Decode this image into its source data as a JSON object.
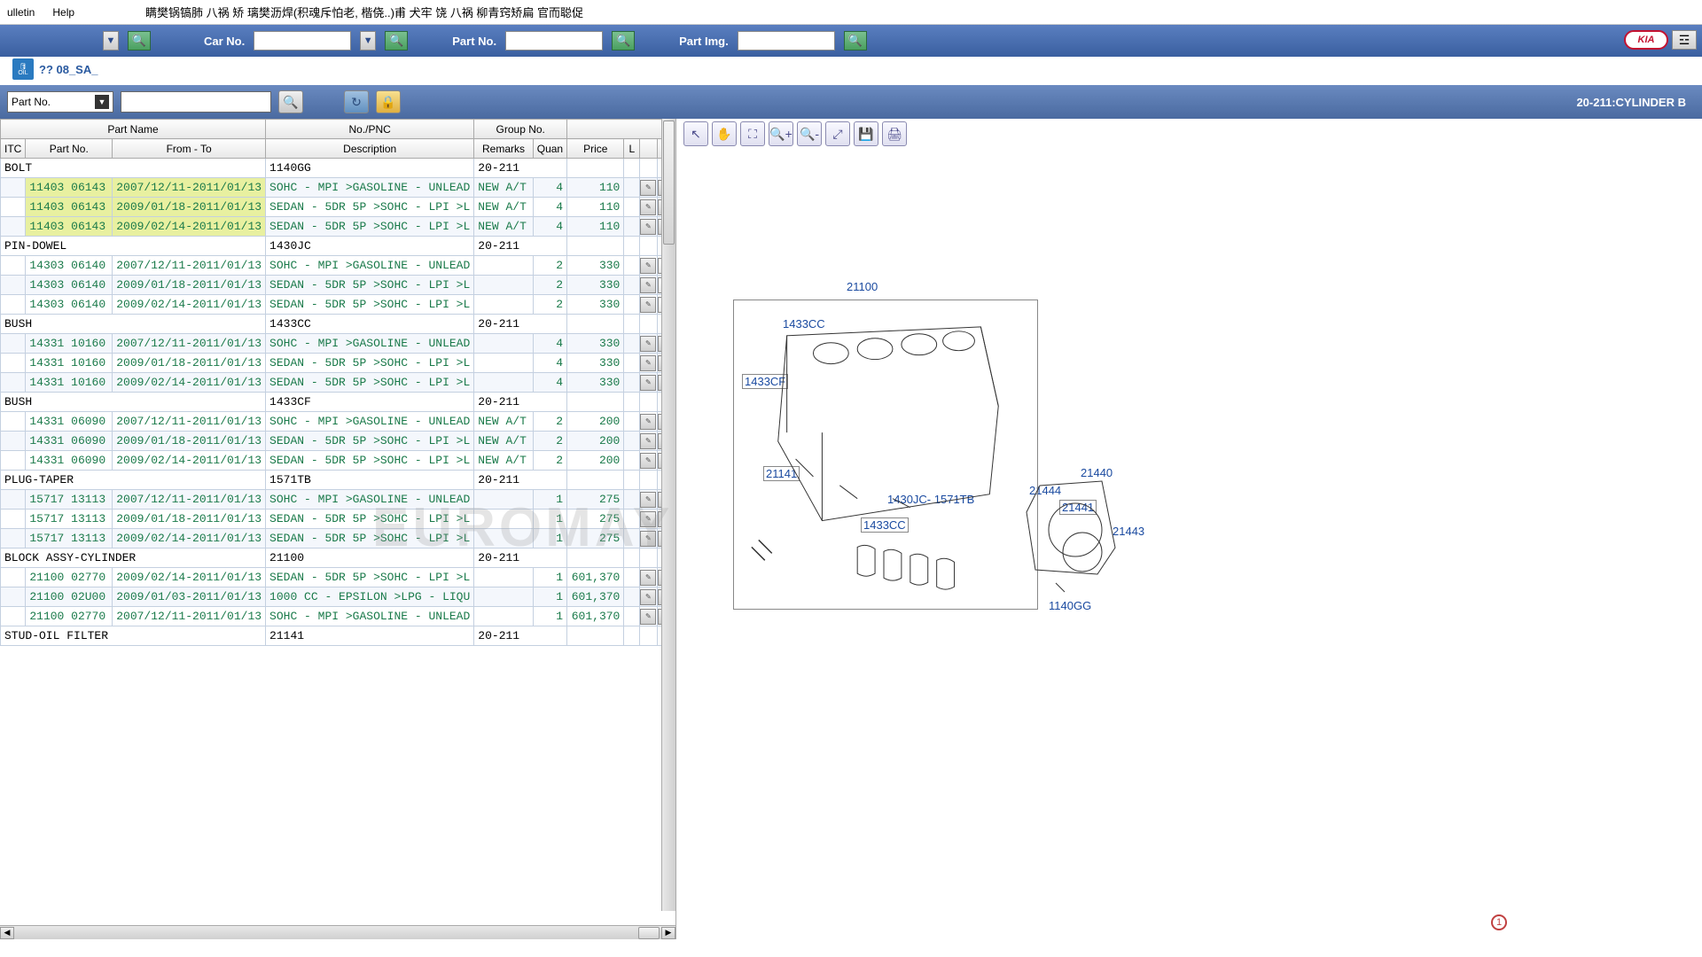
{
  "menu": {
    "bulletin": "ulletin",
    "help": "Help"
  },
  "banner": "瞒樊锅镐肺 八祸 矫 璃樊沥焊(积魂斥怕老, 楷侥..)甫 犬牢 饶 八祸 柳青窍矫扁 官而聪促",
  "search": {
    "car_label": "Car No.",
    "part_label": "Part No.",
    "img_label": "Part Img.",
    "kia": "KIA"
  },
  "tab": {
    "oil": "OIL",
    "label": "?? 08_SA_"
  },
  "toolbar2": {
    "partno": "Part No."
  },
  "diagram_title": "20-211:CYLINDER B",
  "headers": {
    "part_name": "Part Name",
    "no_pnc": "No./PNC",
    "group_no": "Group No.",
    "itc": "ITC",
    "part_no": "Part No.",
    "from_to": "From - To",
    "description": "Description",
    "remarks": "Remarks",
    "qty": "Quan",
    "price": "Price",
    "l": "L"
  },
  "groups": [
    {
      "name": "BOLT",
      "pnc": "1140GG",
      "grp": "20-211",
      "rows": [
        {
          "hl": true,
          "pn": "11403 06143",
          "ft": "2007/12/11-2011/01/13",
          "desc": "SOHC - MPI >GASOLINE - UNLEAD",
          "rem": "NEW A/T",
          "qty": "4",
          "price": "110",
          "multi": false
        },
        {
          "hl": true,
          "pn": "11403 06143",
          "ft": "2009/01/18-2011/01/13",
          "desc": "SEDAN - 5DR 5P >SOHC - LPI >L",
          "rem": "NEW A/T",
          "qty": "4",
          "price": "110",
          "multi": false
        },
        {
          "hl": true,
          "pn": "11403 06143",
          "ft": "2009/02/14-2011/01/13",
          "desc": "SEDAN - 5DR 5P >SOHC - LPI >L",
          "rem": "NEW A/T",
          "qty": "4",
          "price": "110",
          "multi": false
        }
      ]
    },
    {
      "name": "PIN-DOWEL",
      "pnc": "1430JC",
      "grp": "20-211",
      "rows": [
        {
          "pn": "14303 06140",
          "ft": "2007/12/11-2011/01/13",
          "desc": "SOHC - MPI >GASOLINE - UNLEAD",
          "rem": "",
          "qty": "2",
          "price": "330",
          "multi": true
        },
        {
          "pn": "14303 06140",
          "ft": "2009/01/18-2011/01/13",
          "desc": "SEDAN - 5DR 5P >SOHC - LPI >L",
          "rem": "",
          "qty": "2",
          "price": "330",
          "multi": true
        },
        {
          "pn": "14303 06140",
          "ft": "2009/02/14-2011/01/13",
          "desc": "SEDAN - 5DR 5P >SOHC - LPI >L",
          "rem": "",
          "qty": "2",
          "price": "330",
          "multi": true
        }
      ]
    },
    {
      "name": "BUSH",
      "pnc": "1433CC",
      "grp": "20-211",
      "rows": [
        {
          "pn": "14331 10160",
          "ft": "2007/12/11-2011/01/13",
          "desc": "SOHC - MPI >GASOLINE - UNLEAD",
          "rem": "",
          "qty": "4",
          "price": "330",
          "multi": false
        },
        {
          "pn": "14331 10160",
          "ft": "2009/01/18-2011/01/13",
          "desc": "SEDAN - 5DR 5P >SOHC - LPI >L",
          "rem": "",
          "qty": "4",
          "price": "330",
          "multi": false
        },
        {
          "pn": "14331 10160",
          "ft": "2009/02/14-2011/01/13",
          "desc": "SEDAN - 5DR 5P >SOHC - LPI >L",
          "rem": "",
          "qty": "4",
          "price": "330",
          "multi": false
        }
      ]
    },
    {
      "name": "BUSH",
      "pnc": "1433CF",
      "grp": "20-211",
      "rows": [
        {
          "pn": "14331 06090",
          "ft": "2007/12/11-2011/01/13",
          "desc": "SOHC - MPI >GASOLINE - UNLEAD",
          "rem": "NEW A/T",
          "qty": "2",
          "price": "200",
          "multi": false
        },
        {
          "pn": "14331 06090",
          "ft": "2009/01/18-2011/01/13",
          "desc": "SEDAN - 5DR 5P >SOHC - LPI >L",
          "rem": "NEW A/T",
          "qty": "2",
          "price": "200",
          "multi": false
        },
        {
          "pn": "14331 06090",
          "ft": "2009/02/14-2011/01/13",
          "desc": "SEDAN - 5DR 5P >SOHC - LPI >L",
          "rem": "NEW A/T",
          "qty": "2",
          "price": "200",
          "multi": false
        }
      ]
    },
    {
      "name": "PLUG-TAPER",
      "pnc": "1571TB",
      "grp": "20-211",
      "rows": [
        {
          "pn": "15717 13113",
          "ft": "2007/12/11-2011/01/13",
          "desc": "SOHC - MPI >GASOLINE - UNLEAD",
          "rem": "",
          "qty": "1",
          "price": "275",
          "multi": false
        },
        {
          "pn": "15717 13113",
          "ft": "2009/01/18-2011/01/13",
          "desc": "SEDAN - 5DR 5P >SOHC - LPI >L",
          "rem": "",
          "qty": "1",
          "price": "275",
          "multi": false
        },
        {
          "pn": "15717 13113",
          "ft": "2009/02/14-2011/01/13",
          "desc": "SEDAN - 5DR 5P >SOHC - LPI >L",
          "rem": "",
          "qty": "1",
          "price": "275",
          "multi": false
        }
      ]
    },
    {
      "name": "BLOCK ASSY-CYLINDER",
      "pnc": "21100",
      "grp": "20-211",
      "rows": [
        {
          "pn": "21100 02770",
          "ft": "2009/02/14-2011/01/13",
          "desc": "SEDAN - 5DR 5P >SOHC - LPI >L",
          "rem": "",
          "qty": "1",
          "price": "601,370",
          "multi": false
        },
        {
          "pn": "21100 02U00",
          "ft": "2009/01/03-2011/01/13",
          "desc": "1000 CC - EPSILON >LPG - LIQU",
          "rem": "",
          "qty": "1",
          "price": "601,370",
          "multi": false
        },
        {
          "pn": "21100 02770",
          "ft": "2007/12/11-2011/01/13",
          "desc": "SOHC - MPI >GASOLINE - UNLEAD",
          "rem": "",
          "qty": "1",
          "price": "601,370",
          "multi": false
        }
      ]
    },
    {
      "name": "STUD-OIL FILTER",
      "pnc": "21141",
      "grp": "20-211",
      "rows": []
    }
  ],
  "callouts": {
    "c21100": "21100",
    "c1433cc_top": "1433CC",
    "c1433cf": "1433CF",
    "c21141": "21141",
    "c1430jc": "1430JC- 1571TB",
    "c1433cc_bot": "1433CC",
    "c21440": "21440",
    "c21444": "21444",
    "c21441": "21441",
    "c21443": "21443",
    "c1140gg": "1140GG"
  },
  "badge1": "1",
  "watermark": "EUROMAY"
}
